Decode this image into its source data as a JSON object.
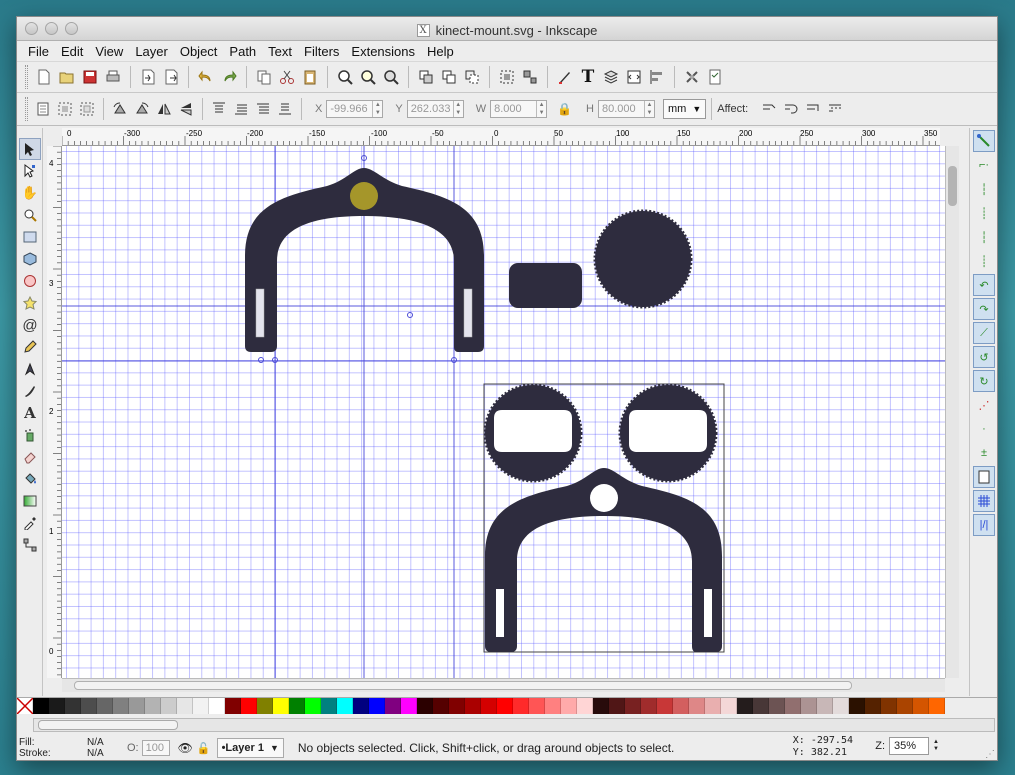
{
  "window": {
    "title": "kinect-mount.svg - Inkscape"
  },
  "menu": [
    "File",
    "Edit",
    "View",
    "Layer",
    "Object",
    "Path",
    "Text",
    "Filters",
    "Extensions",
    "Help"
  ],
  "controls": {
    "x_label": "X",
    "x_value": "-99.966",
    "y_label": "Y",
    "y_value": "262.033",
    "w_label": "W",
    "w_value": "8.000",
    "h_label": "H",
    "h_value": "80.000",
    "unit": "mm",
    "affect_label": "Affect:"
  },
  "rulers": {
    "top_labels": [
      "0",
      "-300",
      "-250",
      "-200",
      "-150",
      "-100",
      "-50",
      "0",
      "50",
      "100",
      "150",
      "200",
      "250",
      "300",
      "350"
    ],
    "left_labels": [
      "4",
      "3",
      "2",
      "1",
      "0"
    ]
  },
  "palette": [
    "#000000",
    "#1a1a1a",
    "#333333",
    "#4d4d4d",
    "#666666",
    "#808080",
    "#999999",
    "#b3b3b3",
    "#cccccc",
    "#e6e6e6",
    "#f2f2f2",
    "#ffffff",
    "#800000",
    "#ff0000",
    "#808000",
    "#ffff00",
    "#008000",
    "#00ff00",
    "#008080",
    "#00ffff",
    "#000080",
    "#0000ff",
    "#800080",
    "#ff00ff",
    "#2b0000",
    "#550000",
    "#800000",
    "#aa0000",
    "#d40000",
    "#ff0000",
    "#ff2a2a",
    "#ff5555",
    "#ff8080",
    "#ffaaaa",
    "#ffd5d5",
    "#280b0b",
    "#501616",
    "#782121",
    "#a02c2c",
    "#c83737",
    "#d35f5f",
    "#de8787",
    "#e9afaf",
    "#f4d7d7",
    "#241c1c",
    "#483737",
    "#6c5353",
    "#916f6f",
    "#ac9393",
    "#c8b7b7",
    "#e3dbdb",
    "#2b1100",
    "#552200",
    "#803300",
    "#aa4400",
    "#d45500",
    "#ff6600"
  ],
  "status": {
    "fill_label": "Fill:",
    "fill_value": "N/A",
    "stroke_label": "Stroke:",
    "stroke_value": "N/A",
    "opacity_label": "O:",
    "opacity_value": "100",
    "layer": "•Layer 1",
    "message": "No objects selected. Click, Shift+click, or drag around objects to select.",
    "x_coord": "X: -297.54",
    "y_coord": "Y:  382.21",
    "zoom_label": "Z:",
    "zoom_value": "35%"
  },
  "colors": {
    "shape_fill": "#2e2c3e",
    "highlight": "#a5962a",
    "guide": "#3b3bd6"
  }
}
